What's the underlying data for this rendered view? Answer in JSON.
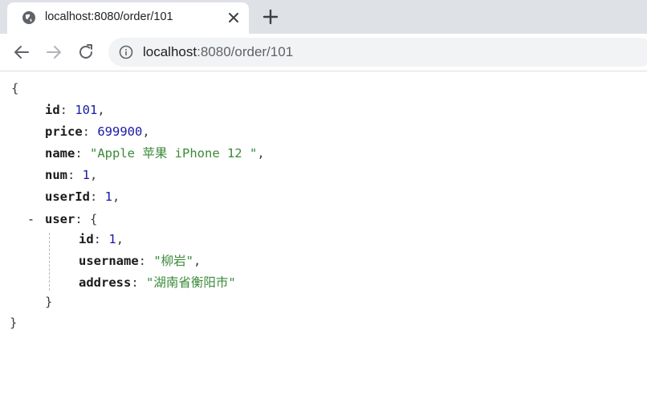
{
  "tab": {
    "title": "localhost:8080/order/101",
    "favicon": "globe-icon",
    "close": "close-icon"
  },
  "new_tab": "plus-icon",
  "nav": {
    "back": "arrow-left-icon",
    "forward": "arrow-right-icon",
    "reload": "reload-icon"
  },
  "address_bar": {
    "host": "localhost",
    "rest": ":8080/order/101",
    "site_info": "info-icon"
  },
  "json": {
    "open_brace": "{",
    "close_brace": "}",
    "fields": [
      {
        "key": "id",
        "value": "101",
        "type": "number"
      },
      {
        "key": "price",
        "value": "699900",
        "type": "number"
      },
      {
        "key": "name",
        "value": "\"Apple 苹果 iPhone 12 \"",
        "type": "string"
      },
      {
        "key": "num",
        "value": "1",
        "type": "number"
      },
      {
        "key": "userId",
        "value": "1",
        "type": "number"
      }
    ],
    "user": {
      "key": "user",
      "collapse_toggle": "-",
      "open": "{",
      "close": "}",
      "fields": [
        {
          "key": "id",
          "value": "1",
          "type": "number"
        },
        {
          "key": "username",
          "value": "\"柳岩\"",
          "type": "string"
        },
        {
          "key": "address",
          "value": "\"湖南省衡阳市\"",
          "type": "string"
        }
      ]
    }
  },
  "colors": {
    "tabstrip": "#dee1e6",
    "number": "#1a1aa6",
    "string": "#3a8a3a"
  }
}
